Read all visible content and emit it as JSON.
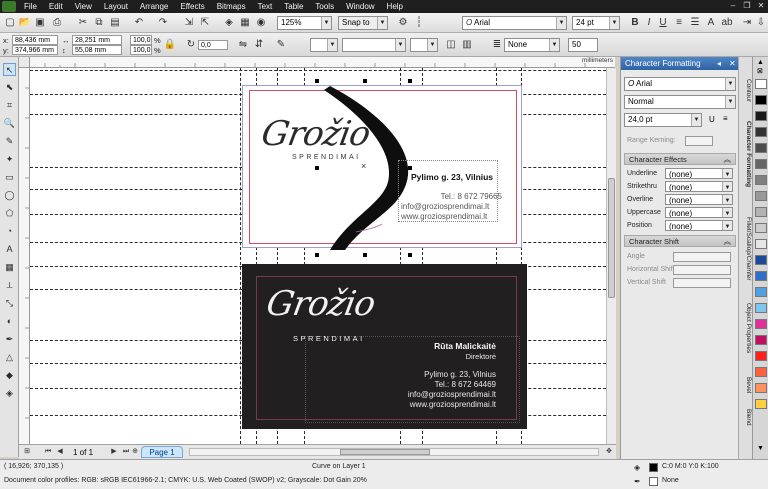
{
  "menu": {
    "items": [
      "File",
      "Edit",
      "View",
      "Layout",
      "Arrange",
      "Effects",
      "Bitmaps",
      "Text",
      "Table",
      "Tools",
      "Window",
      "Help"
    ]
  },
  "toolbar": {
    "zoom": "125%",
    "snap": "Snap to",
    "font": "Arial",
    "font_size": "24 pt"
  },
  "property_bar": {
    "x_label": "x:",
    "x_value": "88,436 mm",
    "y_label": "y:",
    "y_value": "374,966 mm",
    "w_value": "28,251 mm",
    "h_value": "55,08 mm",
    "scale_w": "100,0",
    "scale_h": "100,0",
    "pct": "%",
    "angle": "0,0",
    "outline": "None",
    "value50": "50"
  },
  "ruler": {
    "unit": "millimeters"
  },
  "card_front": {
    "logo_line1": "Grožio",
    "logo_line2": "SPRENDIMAI",
    "address": "Pylimo g. 23, Vilnius",
    "phone": "Tel.: 8 672 79665",
    "email": "info@groziosprendimai.lt",
    "web": "www.groziosprendimai.lt"
  },
  "card_back": {
    "logo_line1": "Grožio",
    "logo_line2": "SPRENDIMAI",
    "name": "Rūta Malickaitė",
    "title": "Direktorė",
    "address": "Pylimo g. 23, Vilnius",
    "phone": "Tel.: 8 672 64469",
    "email": "info@groziosprendimai.lt",
    "web": "www.groziosprendimai.lt"
  },
  "page_nav": {
    "counter": "1 of 1",
    "tab": "Page 1"
  },
  "docker": {
    "title": "Character Formatting",
    "font": "Arial",
    "style": "Normal",
    "size": "24,0 pt",
    "range_kerning": "Range Kerning:",
    "effects_header": "Character Effects",
    "effects": [
      {
        "label": "Underline",
        "value": "(none)"
      },
      {
        "label": "Strikethru",
        "value": "(none)"
      },
      {
        "label": "Overline",
        "value": "(none)"
      },
      {
        "label": "Uppercase",
        "value": "(none)"
      },
      {
        "label": "Position",
        "value": "(none)"
      }
    ],
    "shift_header": "Character Shift",
    "shift": [
      {
        "label": "Angle"
      },
      {
        "label": "Horizontal Shift"
      },
      {
        "label": "Vertical Shift"
      }
    ]
  },
  "tabs": [
    "Contour",
    "Character Formatting",
    "Fillet/Scallop/Chamfer",
    "Object Properties",
    "Bevel",
    "Blend"
  ],
  "palette_colors": [
    "#ffffff",
    "#000000",
    "#1a1a1a",
    "#333333",
    "#4d4d4d",
    "#666666",
    "#808080",
    "#999999",
    "#b3b3b3",
    "#cccccc",
    "#e6e6e6",
    "#1a4a9a",
    "#2f6fc7",
    "#4fa0e0",
    "#7fc7f0",
    "#e0309a",
    "#c01060",
    "#ff2020",
    "#ff6040",
    "#ff9060",
    "#ffcf40"
  ],
  "status": {
    "coords": "( 16,926; 370,135 )",
    "object": "Curve on Layer 1",
    "profile": "Document color profiles: RGB: sRGB IEC61966-2.1; CMYK: U.S. Web Coated (SWOP) v2; Grayscale: Dot Gain 20%",
    "fill": "C:0 M:0 Y:0 K:100",
    "outline": "None"
  }
}
